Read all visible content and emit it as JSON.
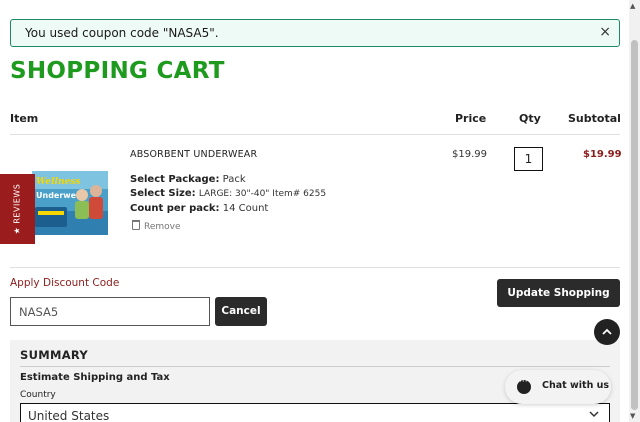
{
  "notice": {
    "message": "You used coupon code \"NASA5\".",
    "close_icon": "×"
  },
  "page_title": "SHOPPING CART",
  "table_headers": {
    "item": "Item",
    "price": "Price",
    "qty": "Qty",
    "subtotal": "Subtotal"
  },
  "cart_item": {
    "name": "ABSORBENT UNDERWEAR",
    "package_label": "Select Package:",
    "package_value": "Pack",
    "size_label": "Select Size:",
    "size_value": "LARGE: 30\"-40\" Item# 6255",
    "count_label": "Count per pack:",
    "count_value": "14 Count",
    "remove_label": "Remove",
    "price": "$19.99",
    "qty": "1",
    "subtotal": "$19.99",
    "image_brand": "Wellness",
    "image_product": "Underwear"
  },
  "reviews_tab": {
    "label": "★ REVIEWS"
  },
  "discount": {
    "label": "Apply Discount Code",
    "code": "NASA5",
    "cancel_label": "Cancel"
  },
  "update_cart_label": "Update Shopping Cart",
  "scroll_top_icon": "^",
  "summary": {
    "title": "SUMMARY",
    "estimate_label": "Estimate Shipping and Tax",
    "country_label": "Country",
    "country_value": "United States"
  },
  "chat": {
    "label": "Chat with us"
  },
  "colors": {
    "brand_green": "#1e9a1e",
    "accent_red": "#8a1c1c",
    "notice_border": "#1f8a67",
    "dark_button": "#2b2b2b"
  }
}
